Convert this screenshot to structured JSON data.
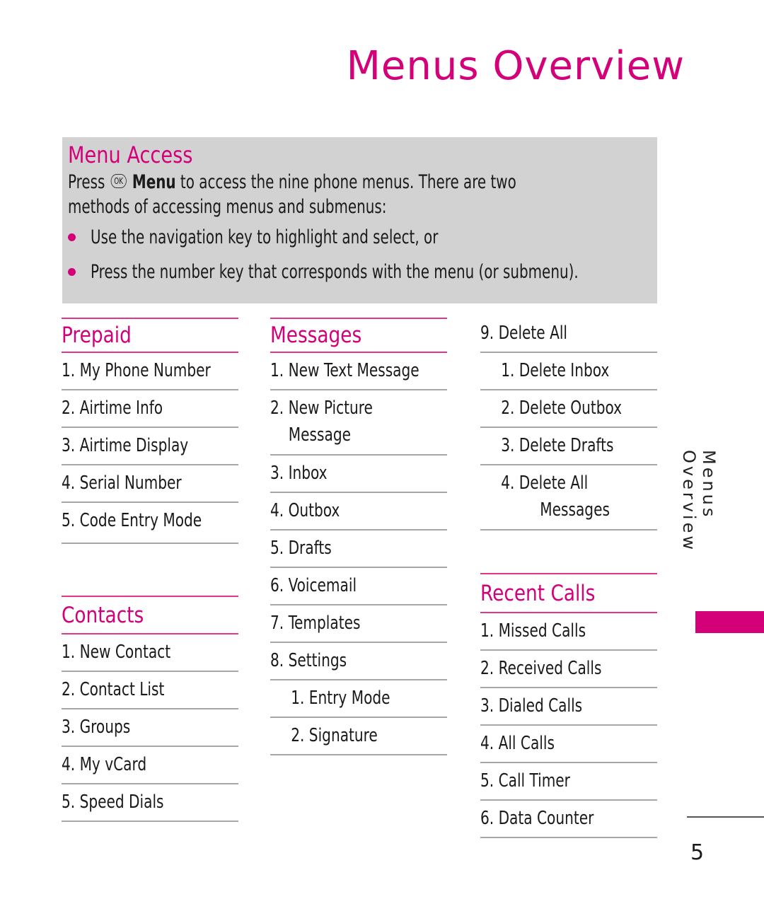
{
  "page": {
    "title": "Menus Overview",
    "side_label": "Menus Overview",
    "page_number": "5",
    "accent_color": "#d4007a"
  },
  "menu_access": {
    "heading": "Menu Access",
    "intro_before_key": "Press",
    "ok_key_label": "OK",
    "intro_bold": "Menu",
    "intro_after_line1": " to access the nine phone menus. There are two",
    "intro_line2": "methods of accessing menus and submenus:",
    "bullets": [
      "Use the navigation key to highlight and select, or",
      "Press the number key that corresponds with the menu (or submenu)."
    ]
  },
  "prepaid": {
    "heading": "Prepaid",
    "items": [
      "1. My Phone Number",
      "2. Airtime Info",
      "3. Airtime Display",
      "4. Serial Number",
      "5. Code Entry Mode"
    ]
  },
  "contacts": {
    "heading": "Contacts",
    "items": [
      "1. New Contact",
      "2. Contact List",
      "3. Groups",
      "4. My vCard",
      "5. Speed Dials"
    ]
  },
  "messages": {
    "heading": "Messages",
    "items": [
      {
        "line1": "1. New Text Message"
      },
      {
        "line1": "2. New Picture",
        "line2": "Message"
      },
      {
        "line1": "3. Inbox"
      },
      {
        "line1": "4. Outbox"
      },
      {
        "line1": "5. Drafts"
      },
      {
        "line1": "6. Voicemail"
      },
      {
        "line1": "7.  Templates"
      },
      {
        "line1": "8. Settings"
      },
      {
        "line1": "1. Entry Mode",
        "sub": true
      },
      {
        "line1": "2. Signature",
        "sub": true
      }
    ]
  },
  "delete_all": {
    "heading": "9. Delete All",
    "items": [
      {
        "line1": "1. Delete Inbox"
      },
      {
        "line1": "2. Delete Outbox"
      },
      {
        "line1": "3. Delete Drafts"
      },
      {
        "line1": "4. Delete All",
        "line2": "Messages"
      }
    ]
  },
  "recent_calls": {
    "heading": "Recent Calls",
    "items": [
      "1. Missed Calls",
      "2. Received Calls",
      "3. Dialed Calls",
      "4. All Calls",
      "5. Call Timer",
      "6. Data Counter"
    ]
  }
}
